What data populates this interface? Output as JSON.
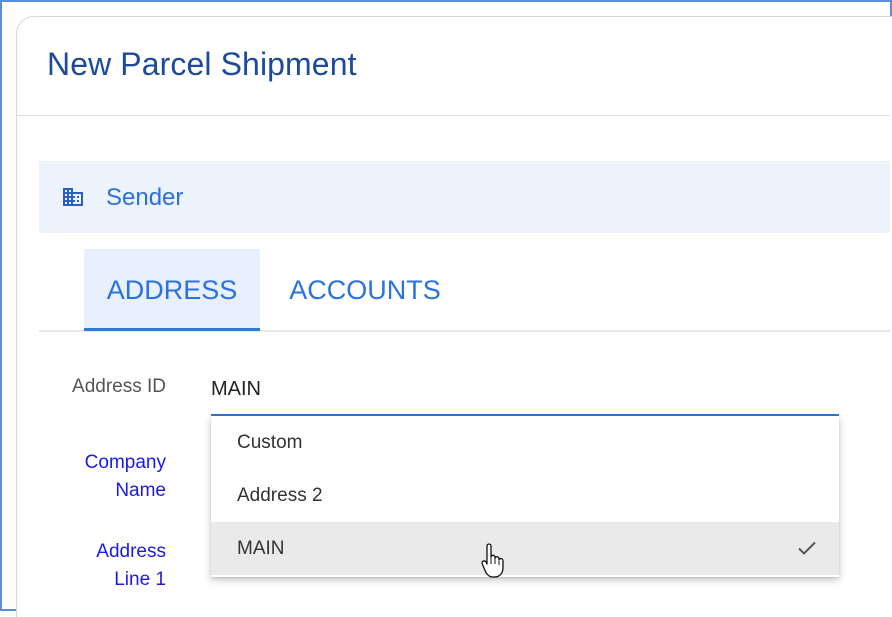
{
  "page": {
    "title": "New Parcel Shipment"
  },
  "section": {
    "label": "Sender",
    "icon": "building-icon"
  },
  "tabs": [
    {
      "label": "ADDRESS",
      "active": true
    },
    {
      "label": "ACCOUNTS",
      "active": false
    }
  ],
  "form": {
    "address_id_label": "Address ID",
    "address_id_value": "MAIN",
    "company_name_label_line1": "Company",
    "company_name_label_line2": "Name",
    "address_line1_label_line1": "Address",
    "address_line1_label_line2": "Line 1"
  },
  "dropdown": {
    "options": [
      {
        "label": "Custom",
        "selected": false
      },
      {
        "label": "Address 2",
        "selected": false
      },
      {
        "label": "MAIN",
        "selected": true
      }
    ],
    "selected_icon": "check-icon"
  },
  "colors": {
    "title": "#1e4a9a",
    "accent": "#2a72e0",
    "section_bg": "#edf3fc",
    "required_label": "#1a1ae6",
    "frame_border": "#5b8ed6"
  }
}
